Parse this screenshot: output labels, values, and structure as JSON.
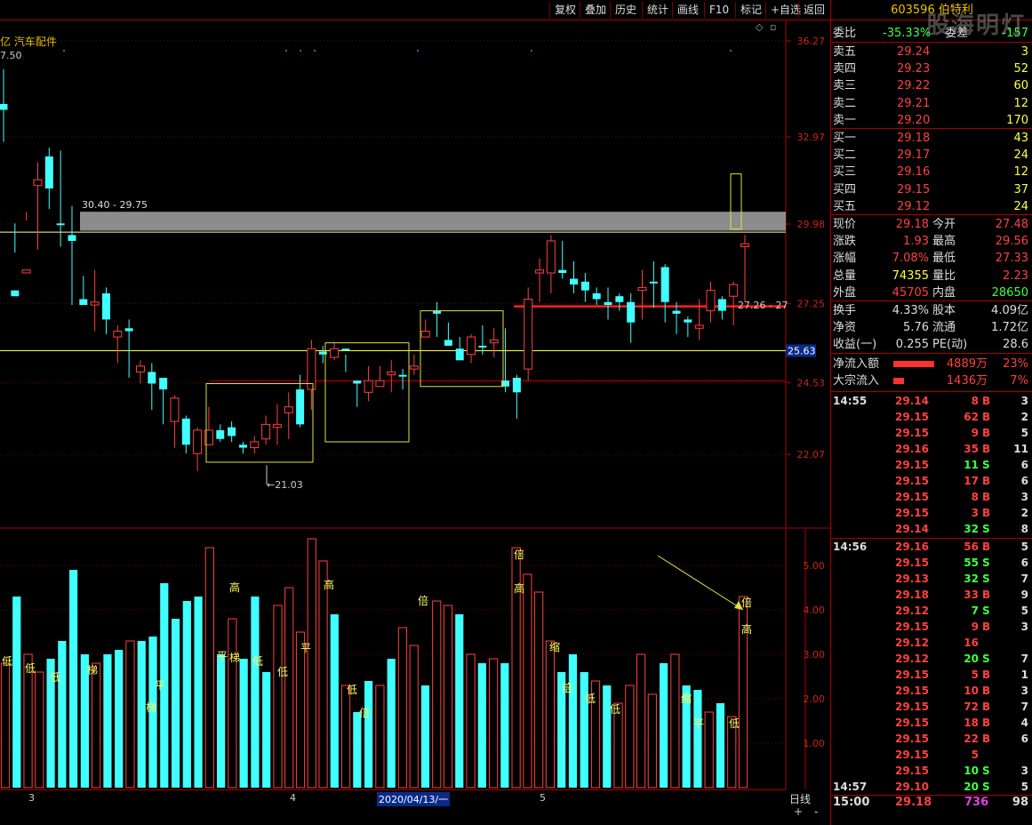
{
  "toolbar": {
    "buttons": [
      "复权",
      "叠加",
      "历史",
      "统计",
      "画线",
      "F10",
      "标记",
      "+自选",
      "返回"
    ]
  },
  "chart": {
    "sector": "亿 汽车配件",
    "top_value": "7.50",
    "price_labels": [
      "36.27",
      "32.97",
      "29.98",
      "27.25",
      "24.53",
      "22.07"
    ],
    "current_price_tag": "25.63",
    "zone_label": "30.40 - 29.75",
    "low_label": "21.03",
    "right_label": "27.26 - 27",
    "vol_labels": [
      "5.00",
      "4.00",
      "3.00",
      "2.00",
      "1.00"
    ],
    "date_labels": [
      "3",
      "4",
      "5"
    ],
    "date_cursor": "2020/04/13/一",
    "period": "日线",
    "plus": "+",
    "minus": "-"
  },
  "stock": {
    "code": "603596",
    "name": "伯特利",
    "watermark": "股海明灯"
  },
  "weibi": {
    "label1": "委比",
    "value1": "-35.33%",
    "label2": "委差",
    "value2": "-157"
  },
  "asks": [
    {
      "label": "卖五",
      "price": "29.24",
      "vol": "3"
    },
    {
      "label": "卖四",
      "price": "29.23",
      "vol": "52"
    },
    {
      "label": "卖三",
      "price": "29.22",
      "vol": "60"
    },
    {
      "label": "卖二",
      "price": "29.21",
      "vol": "12"
    },
    {
      "label": "卖一",
      "price": "29.20",
      "vol": "170"
    }
  ],
  "bids": [
    {
      "label": "买一",
      "price": "29.18",
      "vol": "43"
    },
    {
      "label": "买二",
      "price": "29.17",
      "vol": "24"
    },
    {
      "label": "买三",
      "price": "29.16",
      "vol": "12"
    },
    {
      "label": "买四",
      "price": "29.15",
      "vol": "37"
    },
    {
      "label": "买五",
      "price": "29.12",
      "vol": "24"
    }
  ],
  "quote": [
    {
      "l1": "现价",
      "v1": "29.18",
      "c1": "red",
      "l2": "今开",
      "v2": "27.48",
      "c2": "red"
    },
    {
      "l1": "涨跌",
      "v1": "1.93",
      "c1": "red",
      "l2": "最高",
      "v2": "29.56",
      "c2": "red"
    },
    {
      "l1": "涨幅",
      "v1": "7.08%",
      "c1": "red",
      "l2": "最低",
      "v2": "27.33",
      "c2": "red"
    },
    {
      "l1": "总量",
      "v1": "74355",
      "c1": "yellow",
      "l2": "量比",
      "v2": "2.23",
      "c2": "red"
    },
    {
      "l1": "外盘",
      "v1": "45705",
      "c1": "red",
      "l2": "内盘",
      "v2": "28650",
      "c2": "green"
    }
  ],
  "stats": [
    {
      "l1": "换手",
      "v1": "4.33%",
      "l2": "股本",
      "v2": "4.09亿"
    },
    {
      "l1": "净资",
      "v1": "5.76",
      "l2": "流通",
      "v2": "1.72亿"
    },
    {
      "l1": "收益(一)",
      "v1": "0.255",
      "l2": "PE(动)",
      "v2": "28.6"
    }
  ],
  "flows": [
    {
      "label": "净流入额",
      "amount": "4889万",
      "pct": "23%"
    },
    {
      "label": "大宗流入",
      "amount": "1436万",
      "pct": "7%"
    }
  ],
  "ticks_1": {
    "time": "14:55",
    "rows": [
      [
        "29.14",
        "8",
        "B",
        "3"
      ],
      [
        "29.15",
        "62",
        "B",
        "2"
      ],
      [
        "29.15",
        "9",
        "B",
        "5"
      ],
      [
        "29.16",
        "35",
        "B",
        "11"
      ],
      [
        "29.15",
        "11",
        "S",
        "6"
      ],
      [
        "29.15",
        "17",
        "B",
        "6"
      ],
      [
        "29.15",
        "8",
        "B",
        "3"
      ],
      [
        "29.15",
        "3",
        "B",
        "2"
      ],
      [
        "29.14",
        "32",
        "S",
        "8"
      ]
    ]
  },
  "ticks_2": {
    "time": "14:56",
    "rows": [
      [
        "29.16",
        "56",
        "B",
        "5"
      ],
      [
        "29.15",
        "55",
        "S",
        "6"
      ],
      [
        "29.13",
        "32",
        "S",
        "7"
      ],
      [
        "29.18",
        "33",
        "B",
        "9"
      ],
      [
        "29.12",
        "7",
        "S",
        "5"
      ],
      [
        "29.15",
        "9",
        "B",
        "3"
      ],
      [
        "29.12",
        "16",
        "",
        ""
      ],
      [
        "29.12",
        "20",
        "S",
        "7"
      ],
      [
        "29.15",
        "5",
        "B",
        "1"
      ],
      [
        "29.15",
        "10",
        "B",
        "3"
      ],
      [
        "29.15",
        "72",
        "B",
        "7"
      ],
      [
        "29.15",
        "18",
        "B",
        "4"
      ],
      [
        "29.15",
        "22",
        "B",
        "6"
      ],
      [
        "29.15",
        "5",
        "",
        ""
      ],
      [
        "29.15",
        "10",
        "S",
        "3"
      ]
    ]
  },
  "tick_3": {
    "time": "14:57",
    "price": "29.10",
    "vol": "20",
    "side": "S",
    "num": "5"
  },
  "tick_final": {
    "time": "15:00",
    "price": "29.18",
    "vol": "736",
    "num": "98"
  },
  "chart_data": {
    "type": "candlestick",
    "candles": [
      [
        33.9,
        34.1,
        32.8,
        35.3,
        "d"
      ],
      [
        27.5,
        27.7,
        29.0,
        30.0,
        "d"
      ],
      [
        28.3,
        28.4,
        30.1,
        30.4,
        "u"
      ],
      [
        31.3,
        31.5,
        29.1,
        32.1,
        "u"
      ],
      [
        31.2,
        32.3,
        30.5,
        32.6,
        "d"
      ],
      [
        30.0,
        30.0,
        29.2,
        32.5,
        "d"
      ],
      [
        29.4,
        29.6,
        27.2,
        30.6,
        "d"
      ],
      [
        27.2,
        27.4,
        27.3,
        28.2,
        "d"
      ],
      [
        27.2,
        27.3,
        26.3,
        28.4,
        "u"
      ],
      [
        26.7,
        27.6,
        26.2,
        27.8,
        "d"
      ],
      [
        26.1,
        26.3,
        25.2,
        26.5,
        "u"
      ],
      [
        26.3,
        26.4,
        24.7,
        26.7,
        "d"
      ],
      [
        24.9,
        25.1,
        24.5,
        25.3,
        "u"
      ],
      [
        24.5,
        24.9,
        23.6,
        25.2,
        "d"
      ],
      [
        24.3,
        24.7,
        23.1,
        24.6,
        "d"
      ],
      [
        23.2,
        24.0,
        22.3,
        24.1,
        "u"
      ],
      [
        22.4,
        23.3,
        22.1,
        23.4,
        "d"
      ],
      [
        22.1,
        22.9,
        21.5,
        23.0,
        "u"
      ],
      [
        22.4,
        22.9,
        22.6,
        23.7,
        "u"
      ],
      [
        22.6,
        22.9,
        22.5,
        23.1,
        "d"
      ],
      [
        22.7,
        23.0,
        22.5,
        23.2,
        "d"
      ],
      [
        22.3,
        22.4,
        22.1,
        22.5,
        "d"
      ],
      [
        22.3,
        22.5,
        22.1,
        22.7,
        "u"
      ],
      [
        22.6,
        23.1,
        22.4,
        23.4,
        "u"
      ],
      [
        23.0,
        23.1,
        22.4,
        23.8,
        "u"
      ],
      [
        23.5,
        23.7,
        22.6,
        24.2,
        "u"
      ],
      [
        23.1,
        24.3,
        23.0,
        24.8,
        "d"
      ],
      [
        24.3,
        25.7,
        23.6,
        26.0,
        "u"
      ],
      [
        25.5,
        25.6,
        25.2,
        25.8,
        "d"
      ],
      [
        25.4,
        25.7,
        25.3,
        25.9,
        "u"
      ],
      [
        25.7,
        25.7,
        24.9,
        25.5,
        "d"
      ],
      [
        24.5,
        24.6,
        23.7,
        24.5,
        "d"
      ],
      [
        24.2,
        24.6,
        23.9,
        25.1,
        "u"
      ],
      [
        24.4,
        24.6,
        24.4,
        25.1,
        "u"
      ],
      [
        24.8,
        24.9,
        24.2,
        25.3,
        "u"
      ],
      [
        24.8,
        24.8,
        24.3,
        25.0,
        "d"
      ],
      [
        25.0,
        25.1,
        24.8,
        25.5,
        "u"
      ],
      [
        26.1,
        26.3,
        26.2,
        26.7,
        "u"
      ],
      [
        26.9,
        27.0,
        26.1,
        27.3,
        "d"
      ],
      [
        25.8,
        26.0,
        25.8,
        26.6,
        "d"
      ],
      [
        25.3,
        25.7,
        25.4,
        26.1,
        "d"
      ],
      [
        25.5,
        26.1,
        25.2,
        26.2,
        "u"
      ],
      [
        25.8,
        25.8,
        25.5,
        26.5,
        "d"
      ],
      [
        25.9,
        26.0,
        25.4,
        26.4,
        "u"
      ],
      [
        24.4,
        24.6,
        24.2,
        26.4,
        "d"
      ],
      [
        24.2,
        24.7,
        23.3,
        24.8,
        "d"
      ],
      [
        25.0,
        27.4,
        24.6,
        27.8,
        "u"
      ],
      [
        28.3,
        28.4,
        27.3,
        28.8,
        "u"
      ],
      [
        28.3,
        29.4,
        27.6,
        29.6,
        "u"
      ],
      [
        28.3,
        28.4,
        28.1,
        29.4,
        "d"
      ],
      [
        27.9,
        28.1,
        27.6,
        28.7,
        "d"
      ],
      [
        27.7,
        28.0,
        27.3,
        28.3,
        "d"
      ],
      [
        27.4,
        27.6,
        27.2,
        27.8,
        "d"
      ],
      [
        27.2,
        27.3,
        26.7,
        27.8,
        "d"
      ],
      [
        27.3,
        27.5,
        27.0,
        27.6,
        "d"
      ],
      [
        26.6,
        27.3,
        25.9,
        27.6,
        "d"
      ],
      [
        27.7,
        27.8,
        26.7,
        28.4,
        "u"
      ],
      [
        28.0,
        28.0,
        27.1,
        28.7,
        "d"
      ],
      [
        27.3,
        28.5,
        26.6,
        28.6,
        "d"
      ],
      [
        26.9,
        27.0,
        26.2,
        27.3,
        "d"
      ],
      [
        26.7,
        26.6,
        26.1,
        26.8,
        "d"
      ],
      [
        26.4,
        26.5,
        26.0,
        27.4,
        "u"
      ],
      [
        27.0,
        27.7,
        26.6,
        28.0,
        "u"
      ],
      [
        27.0,
        27.4,
        26.7,
        27.5,
        "d"
      ],
      [
        27.5,
        27.9,
        26.5,
        28.0,
        "u"
      ],
      [
        29.2,
        29.3,
        27.3,
        29.6,
        "u"
      ]
    ],
    "volume": [
      [
        2.8,
        "u"
      ],
      [
        4.3,
        "d"
      ],
      [
        3.0,
        "u"
      ],
      [
        2.6,
        "u"
      ],
      [
        2.9,
        "d"
      ],
      [
        3.3,
        "d"
      ],
      [
        4.9,
        "d"
      ],
      [
        3.0,
        "d"
      ],
      [
        2.8,
        "u"
      ],
      [
        3.0,
        "d"
      ],
      [
        3.1,
        "d"
      ],
      [
        3.3,
        "u"
      ],
      [
        3.3,
        "d"
      ],
      [
        3.4,
        "d"
      ],
      [
        4.6,
        "d"
      ],
      [
        3.8,
        "d"
      ],
      [
        4.2,
        "d"
      ],
      [
        4.3,
        "d"
      ],
      [
        5.4,
        "u"
      ],
      [
        3.0,
        "d"
      ],
      [
        3.8,
        "u"
      ],
      [
        2.9,
        "d"
      ],
      [
        4.3,
        "d"
      ],
      [
        2.6,
        "d"
      ],
      [
        4.1,
        "u"
      ],
      [
        4.5,
        "u"
      ],
      [
        3.5,
        "u"
      ],
      [
        5.6,
        "u"
      ],
      [
        5.1,
        "u"
      ],
      [
        3.9,
        "d"
      ],
      [
        2.3,
        "u"
      ],
      [
        1.7,
        "d"
      ],
      [
        2.4,
        "d"
      ],
      [
        2.3,
        "u"
      ],
      [
        2.9,
        "d"
      ],
      [
        3.6,
        "u"
      ],
      [
        3.2,
        "u"
      ],
      [
        2.3,
        "d"
      ],
      [
        4.2,
        "u"
      ],
      [
        4.1,
        "u"
      ],
      [
        3.9,
        "d"
      ],
      [
        3.0,
        "u"
      ],
      [
        2.8,
        "d"
      ],
      [
        2.9,
        "u"
      ],
      [
        2.8,
        "d"
      ],
      [
        5.4,
        "u"
      ],
      [
        4.8,
        "u"
      ],
      [
        4.4,
        "u"
      ],
      [
        3.3,
        "u"
      ],
      [
        2.6,
        "d"
      ],
      [
        3.0,
        "d"
      ],
      [
        2.6,
        "d"
      ],
      [
        2.4,
        "u"
      ],
      [
        2.3,
        "d"
      ],
      [
        1.9,
        "u"
      ],
      [
        2.3,
        "u"
      ],
      [
        3.0,
        "u"
      ],
      [
        2.1,
        "u"
      ],
      [
        2.8,
        "d"
      ],
      [
        3.0,
        "u"
      ],
      [
        2.3,
        "d"
      ],
      [
        2.2,
        "d"
      ],
      [
        1.7,
        "u"
      ],
      [
        1.9,
        "d"
      ],
      [
        1.6,
        "u"
      ],
      [
        4.3,
        "u"
      ]
    ],
    "price_ylim": [
      19.6,
      37.0
    ],
    "volume_ylim": [
      0,
      5.8
    ]
  }
}
